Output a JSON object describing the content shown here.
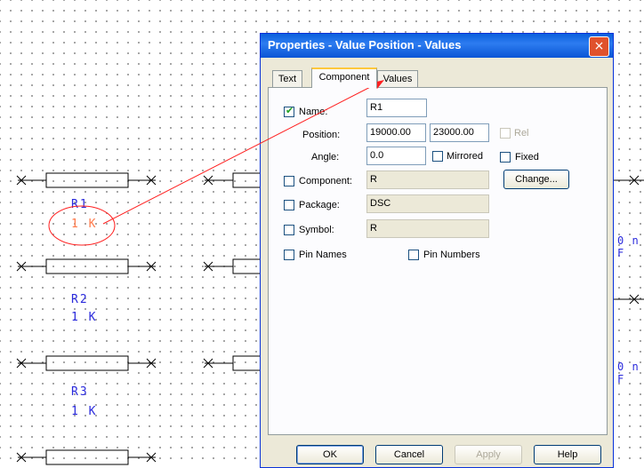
{
  "schematic": {
    "components": [
      {
        "ref": "R1",
        "value": "1 K",
        "selected": true
      },
      {
        "ref": "R2",
        "value": "1 K",
        "selected": false
      },
      {
        "ref": "R3",
        "value": "1 K",
        "selected": false
      }
    ],
    "right_labels": [
      "0 n F",
      "0 n F"
    ]
  },
  "dialog": {
    "title": "Properties - Value Position - Values",
    "close": "×",
    "tabs": [
      "Text",
      "Component",
      "Values"
    ],
    "active_tab": "Component",
    "fields": {
      "name_label": "Name:",
      "name_checked": true,
      "name_value": "R1",
      "position_label": "Position:",
      "position_x": "19000.00",
      "position_y": "23000.00",
      "rel_label": "Rel",
      "angle_label": "Angle:",
      "angle_value": "0.0",
      "mirrored_label": "Mirrored",
      "fixed_label": "Fixed",
      "component_label": "Component:",
      "component_value": "R",
      "change_button": "Change...",
      "package_label": "Package:",
      "package_value": "DSC",
      "symbol_label": "Symbol:",
      "symbol_value": "R",
      "pin_names_label": "Pin Names",
      "pin_numbers_label": "Pin Numbers"
    },
    "buttons": {
      "ok": "OK",
      "cancel": "Cancel",
      "apply": "Apply",
      "help": "Help"
    }
  },
  "colors": {
    "annotation": "#ff2020",
    "label": "#2a2adc",
    "selected_value": "#ff7a4a"
  }
}
